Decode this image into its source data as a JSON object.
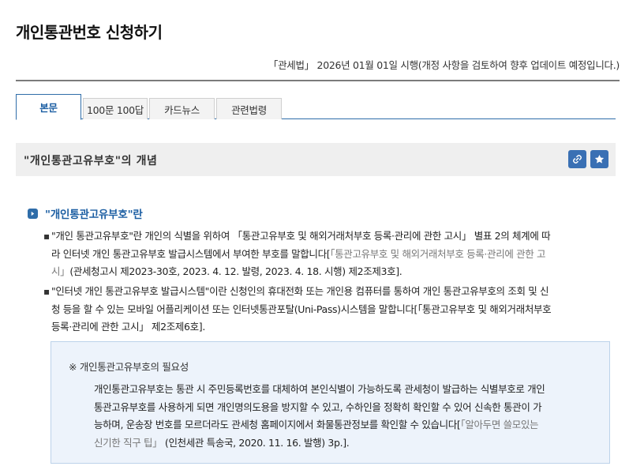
{
  "page": {
    "title": "개인통관번호 신청하기"
  },
  "law_info": "「관세법」 2026년 01월 01일 시행(개정 사항을 검토하여 향후 업데이트 예정입니다.)",
  "tabs": [
    {
      "label": "본문",
      "active": true
    },
    {
      "label": "100문 100답",
      "active": false
    },
    {
      "label": "카드뉴스",
      "active": false
    },
    {
      "label": "관련법령",
      "active": false
    }
  ],
  "section": {
    "title": "\"개인통관고유부호\"의 개념",
    "link_icon": "link-icon",
    "bookmark_icon": "star-icon"
  },
  "subheading": "\"개인통관고유부호\"란",
  "paragraphs": [
    {
      "bullet": "▪",
      "lines": [
        [
          "\"개인 통관고유부호\"란 개인의 식별을 위하여 「통관고유부호 및 해외거래처부호 등록·관리에 관한 고시」 별표 2의 체계에 따"
        ],
        [
          "라 인터넷 개인 통관고유부호 발급시스템에서 부여한 부호를 말합니다[",
          "「통관고유부호 및 해외거래처부호 등록·관리에 관한 고"
        ],
        [
          "",
          "시」",
          "(관세청고시 제2023-30호, 2023. 4. 12. 발령, 2023. 4. 18. 시행) 제2조제3호]."
        ]
      ]
    },
    {
      "bullet": "▪",
      "lines": [
        [
          "\"인터넷 개인 통관고유부호 발급시스템\"이란 신청인의 휴대전화 또는 개인용 컴퓨터를 통하여 개인 통관고유부호의 조회 및 신"
        ],
        [
          "청 등을 할 수 있는 모바일 어플리케이션 또는 인터넷통관포탈(Uni-Pass)시스템을 말합니다[「통관고유부호 및 해외거래처부호"
        ],
        [
          "등록·관리에 관한 고시」 제2조제6호]."
        ]
      ]
    }
  ],
  "note": {
    "title": "※ 개인통관고유부호의 필요성",
    "lines": [
      [
        "개인통관고유부호는 통관 시 주민등록번호를 대체하여 본인식별이 가능하도록 관세청이 발급하는 식별부호로 개인"
      ],
      [
        "통관고유부호를 사용하게 되면 개인명의도용을 방지할 수 있고, 수하인을 정확히 확인할 수 있어 신속한 통관이 가"
      ],
      [
        "능하며, 운송장 번호를 모르더라도 관세청 홈페이지에서 화물통관정보를 확인할 수 있습니다[",
        "「알아두면 쓸모있는"
      ],
      [
        "",
        "신기한 직구 팁」",
        " (인천세관 특송국, 2020. 11. 16. 발행) 3p.]."
      ]
    ]
  },
  "colors": {
    "accent": "#2f6da9",
    "icon_button": "#3a70b4",
    "note_background": "#edf3fb",
    "reference_text": "#777777"
  }
}
